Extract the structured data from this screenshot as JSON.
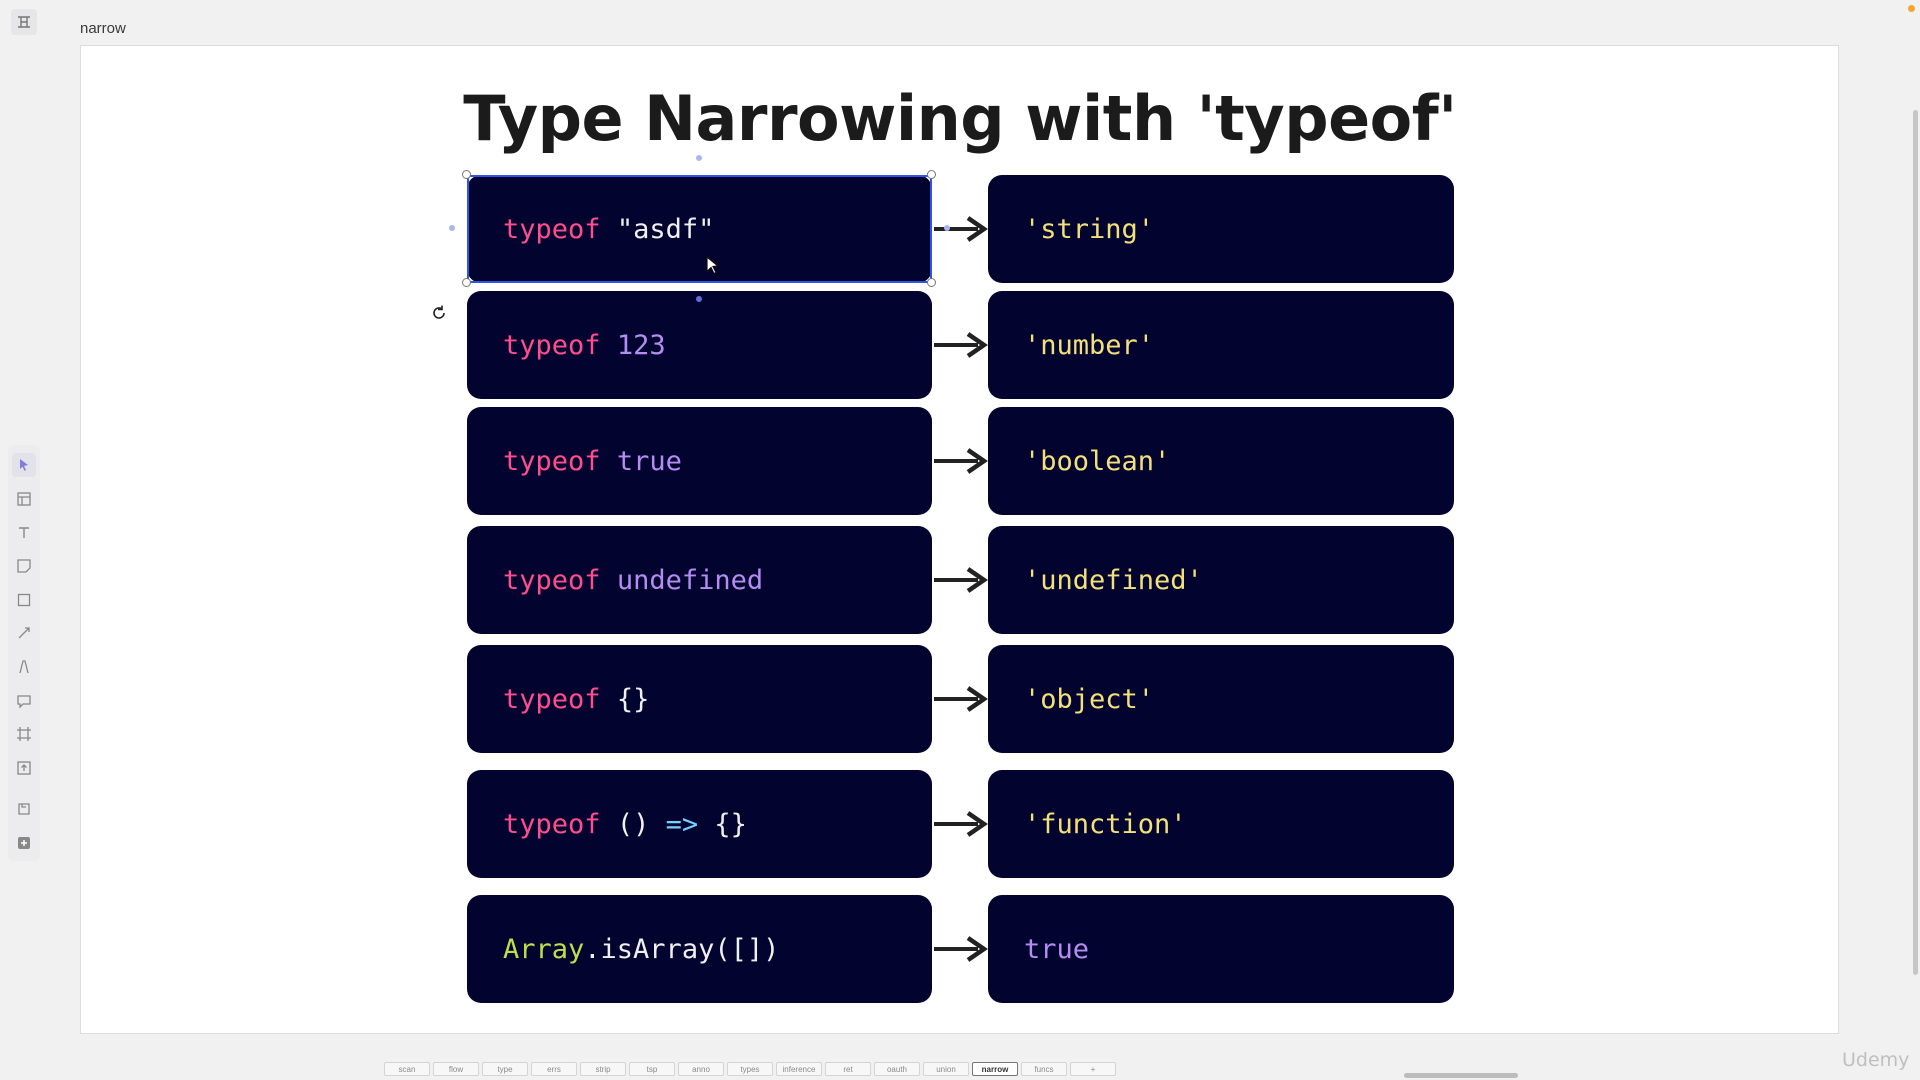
{
  "frame": {
    "name": "narrow"
  },
  "slide": {
    "title": "Type Narrowing with 'typeof'",
    "rows": [
      {
        "left": [
          {
            "t": "typeof",
            "c": "kw"
          },
          {
            "t": " ",
            "c": "plain"
          },
          {
            "t": "\"asdf\"",
            "c": "plain"
          }
        ],
        "right": [
          {
            "t": "'string'",
            "c": "str"
          }
        ]
      },
      {
        "left": [
          {
            "t": "typeof",
            "c": "kw"
          },
          {
            "t": " ",
            "c": "plain"
          },
          {
            "t": "123",
            "c": "lit"
          }
        ],
        "right": [
          {
            "t": "'number'",
            "c": "str"
          }
        ]
      },
      {
        "left": [
          {
            "t": "typeof",
            "c": "kw"
          },
          {
            "t": " ",
            "c": "plain"
          },
          {
            "t": "true",
            "c": "lit"
          }
        ],
        "right": [
          {
            "t": "'boolean'",
            "c": "str"
          }
        ]
      },
      {
        "left": [
          {
            "t": "typeof",
            "c": "kw"
          },
          {
            "t": " ",
            "c": "plain"
          },
          {
            "t": "undefined",
            "c": "lit"
          }
        ],
        "right": [
          {
            "t": "'undefined'",
            "c": "str"
          }
        ]
      },
      {
        "left": [
          {
            "t": "typeof",
            "c": "kw"
          },
          {
            "t": " ",
            "c": "plain"
          },
          {
            "t": "{}",
            "c": "plain"
          }
        ],
        "right": [
          {
            "t": "'object'",
            "c": "str"
          }
        ]
      },
      {
        "left": [
          {
            "t": "typeof",
            "c": "kw"
          },
          {
            "t": " ",
            "c": "plain"
          },
          {
            "t": "()",
            "c": "plain"
          },
          {
            "t": " ",
            "c": "plain"
          },
          {
            "t": "=>",
            "c": "cyan"
          },
          {
            "t": " ",
            "c": "plain"
          },
          {
            "t": "{}",
            "c": "plain"
          }
        ],
        "right": [
          {
            "t": "'function'",
            "c": "str"
          }
        ]
      },
      {
        "left": [
          {
            "t": "Array",
            "c": "green"
          },
          {
            "t": ".isArray([])",
            "c": "plain"
          }
        ],
        "right": [
          {
            "t": "true",
            "c": "lit"
          }
        ]
      }
    ]
  },
  "tabs": [
    "scan",
    "flow",
    "type",
    "errs",
    "strip",
    "tsp",
    "anno",
    "types",
    "inference",
    "ret",
    "oauth",
    "union",
    "narrow",
    "funcs",
    "+"
  ],
  "active_tab": "narrow",
  "watermark": "Udemy",
  "colors": {
    "box_bg": "#03032f",
    "keyword": "#ff4d8d",
    "literal": "#b48cf2",
    "string": "#f2e17b",
    "selection": "#2f55e4"
  }
}
